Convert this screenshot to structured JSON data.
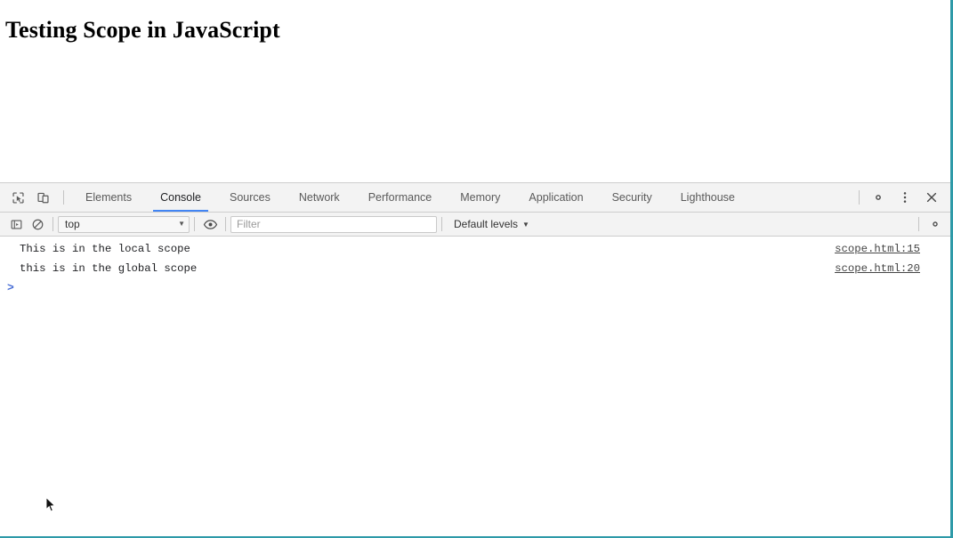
{
  "page": {
    "heading": "Testing Scope in JavaScript"
  },
  "devtools": {
    "toolbar_icons": {
      "inspect": "inspect-element-icon",
      "device": "device-toolbar-icon"
    },
    "tabs": [
      {
        "label": "Elements",
        "active": false
      },
      {
        "label": "Console",
        "active": true
      },
      {
        "label": "Sources",
        "active": false
      },
      {
        "label": "Network",
        "active": false
      },
      {
        "label": "Performance",
        "active": false
      },
      {
        "label": "Memory",
        "active": false
      },
      {
        "label": "Application",
        "active": false
      },
      {
        "label": "Security",
        "active": false
      },
      {
        "label": "Lighthouse",
        "active": false
      }
    ],
    "right_actions": [
      {
        "name": "settings-gear-icon"
      },
      {
        "name": "more-options-icon"
      },
      {
        "name": "close-devtools-icon"
      }
    ],
    "console_toolbar": {
      "sidebar_toggle": "console-sidebar-icon",
      "clear_console": "clear-console-icon",
      "context": "top",
      "context_caret": "▼",
      "live_expression": "eye-icon",
      "filter_placeholder": "Filter",
      "filter_value": "",
      "levels": "Default levels",
      "levels_caret": "▼",
      "settings": "console-settings-icon"
    },
    "messages": [
      {
        "text": "This is in the local scope",
        "source": "scope.html:15"
      },
      {
        "text": "this is in the global scope",
        "source": "scope.html:20"
      }
    ],
    "prompt": ">"
  },
  "colors": {
    "accent_blue": "#4285f4",
    "page_border_teal": "#2e9aa8",
    "toolbar_bg": "#f3f3f3",
    "prompt_blue": "#4a6fd6"
  }
}
